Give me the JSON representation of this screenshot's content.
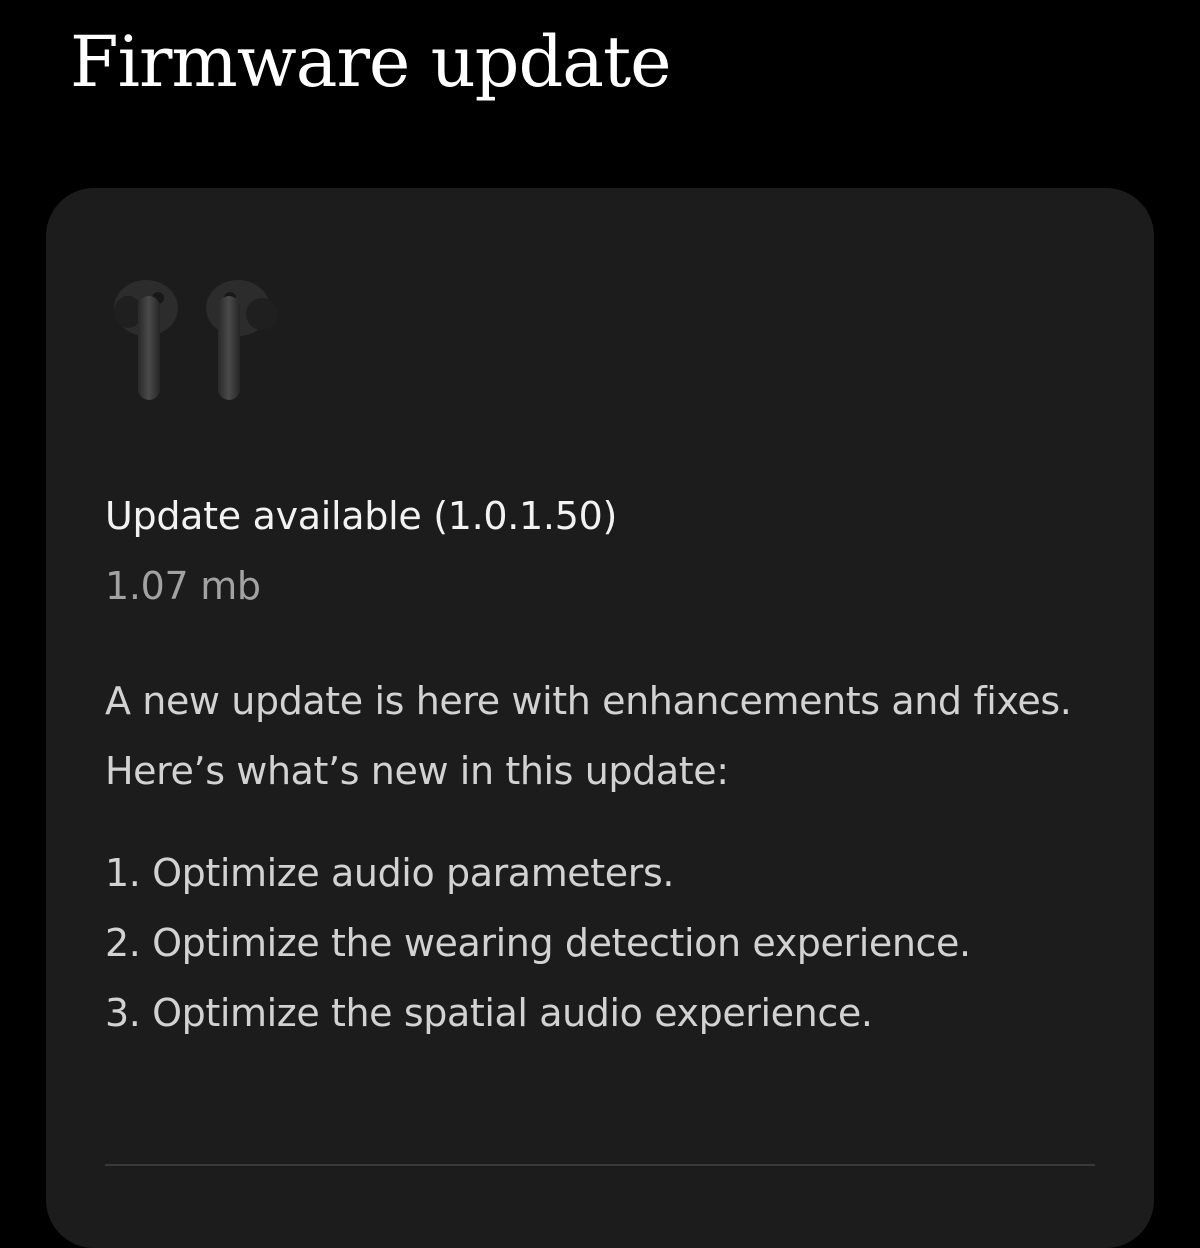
{
  "header": {
    "title": "Firmware update"
  },
  "card": {
    "image_icon": "earbuds-icon",
    "update_title": "Update available (1.0.1.50)",
    "size": "1.07 mb",
    "description": "A new update is here with enhancements and fixes. Here’s what’s new in this update:",
    "changelog": [
      "1. Optimize audio parameters.",
      "2. Optimize the wearing detection experience.",
      "3. Optimize the spatial audio experience."
    ]
  },
  "colors": {
    "background": "#000000",
    "card": "#1c1c1c",
    "title_text": "#ffffff",
    "secondary_text": "#a2a2a2"
  }
}
